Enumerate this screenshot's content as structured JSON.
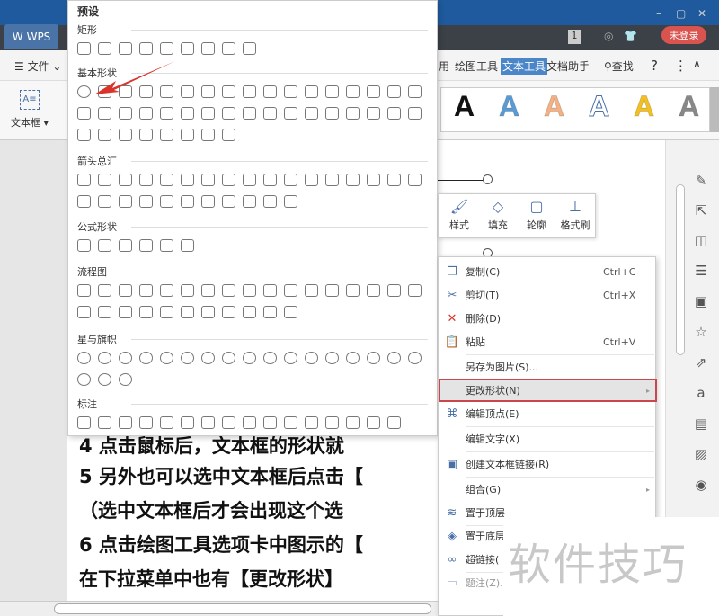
{
  "titlebar": {
    "app_tab": "WPS",
    "badge": "1",
    "login": "未登录",
    "min": "–",
    "max": "▢",
    "close": "✕"
  },
  "menu": {
    "file": "文件",
    "items": [
      "用",
      "绘图工具",
      "文本工具",
      "文档助手"
    ],
    "search": "查找",
    "help": "?",
    "more": "⋮",
    "collapse": "∧"
  },
  "ribbon": {
    "textbox_label": "文本框",
    "style_letters": [
      "A",
      "A",
      "A",
      "A",
      "A",
      "A"
    ],
    "style_colors": [
      "#111111",
      "#5b9bd5",
      "#f4b183",
      "#ffffff",
      "#f2c021",
      "#888888"
    ]
  },
  "shape_panel": {
    "title": "预设",
    "sections": [
      {
        "name": "矩形",
        "count": 9
      },
      {
        "name": "基本形状",
        "count": 42
      },
      {
        "name": "箭头总汇",
        "count": 28
      },
      {
        "name": "公式形状",
        "count": 6
      },
      {
        "name": "流程图",
        "count": 28
      },
      {
        "name": "星与旗帜",
        "count": 20
      },
      {
        "name": "标注",
        "count": 16
      }
    ]
  },
  "mini_toolbar": {
    "items": [
      {
        "label": "样式",
        "icon": "brush-icon"
      },
      {
        "label": "填充",
        "icon": "fill-bucket-icon"
      },
      {
        "label": "轮廓",
        "icon": "outline-icon"
      },
      {
        "label": "格式刷",
        "icon": "format-painter-icon"
      }
    ]
  },
  "context_menu": {
    "items": [
      {
        "label": "复制(C)",
        "shortcut": "Ctrl+C",
        "icon": "copy-icon",
        "glyph": "❐"
      },
      {
        "label": "剪切(T)",
        "shortcut": "Ctrl+X",
        "icon": "scissors-icon",
        "glyph": "✂"
      },
      {
        "label": "删除(D)",
        "shortcut": "",
        "icon": "delete-icon",
        "glyph": "✕"
      },
      {
        "label": "粘贴",
        "shortcut": "Ctrl+V",
        "icon": "paste-icon",
        "glyph": "📋"
      },
      {
        "label": "另存为图片(S)...",
        "shortcut": "",
        "icon": "",
        "glyph": ""
      },
      {
        "label": "更改形状(N)",
        "shortcut": "▸",
        "icon": "",
        "glyph": "",
        "highlighted": true
      },
      {
        "label": "编辑顶点(E)",
        "shortcut": "",
        "icon": "edit-points-icon",
        "glyph": "⌘"
      },
      {
        "label": "编辑文字(X)",
        "shortcut": "",
        "icon": "",
        "glyph": ""
      },
      {
        "label": "创建文本框链接(R)",
        "shortcut": "",
        "icon": "textbox-link-icon",
        "glyph": "▣"
      },
      {
        "label": "组合(G)",
        "shortcut": "▸",
        "icon": "",
        "glyph": ""
      },
      {
        "label": "置于顶层",
        "shortcut": "",
        "icon": "bring-front-icon",
        "glyph": "≋"
      },
      {
        "label": "置于底层",
        "shortcut": "",
        "icon": "send-back-icon",
        "glyph": "◈"
      },
      {
        "label": "超链接(",
        "shortcut": "",
        "icon": "link-icon",
        "glyph": "∞"
      },
      {
        "label": "题注(Z)..",
        "shortcut": "",
        "icon": "caption-icon",
        "glyph": "▭"
      }
    ]
  },
  "document": {
    "lines": [
      "4 点击鼠标后，文本框的形状就",
      "5 另外也可以选中文本框后点击【",
      "（选中文本框后才会出现这个选",
      "6 点击绘图工具选项卡中图示的【",
      "在下拉菜单中也有【更改形状】"
    ]
  },
  "watermark": "软件技巧"
}
